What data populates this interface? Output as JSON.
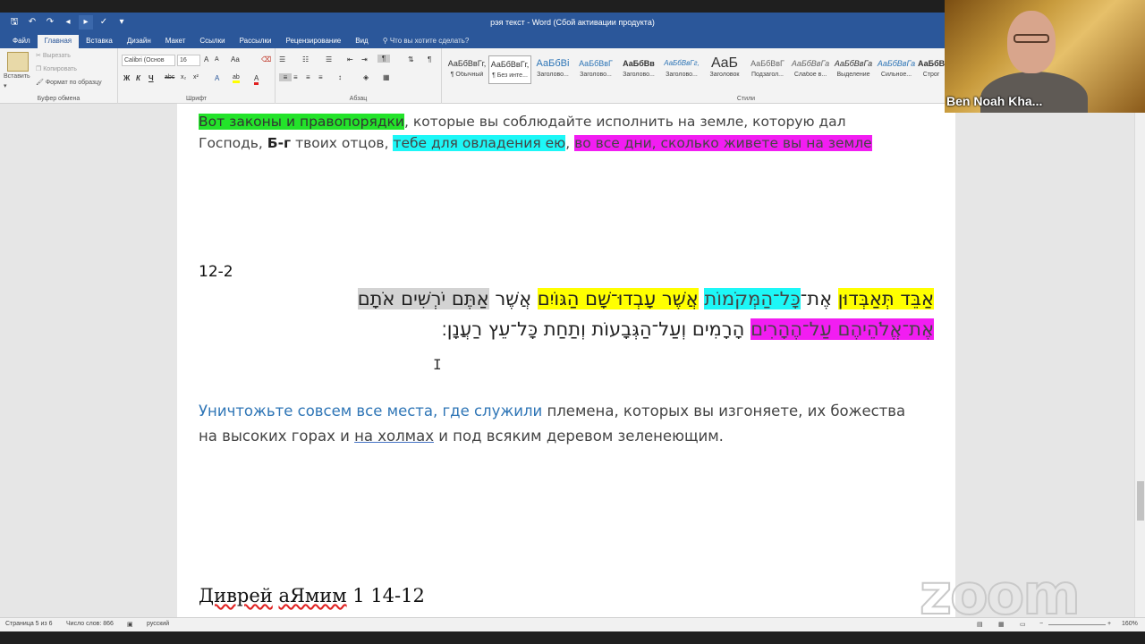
{
  "window": {
    "title": "рэя текст - Word (Сбой активации продукта)"
  },
  "quick_access": {
    "icons": [
      "save-icon",
      "undo-icon",
      "redo-icon",
      "voice-icon",
      "voice-icon",
      "check-icon",
      "more-icon"
    ]
  },
  "tabs": [
    {
      "label": "Файл"
    },
    {
      "label": "Главная",
      "active": true
    },
    {
      "label": "Вставка"
    },
    {
      "label": "Дизайн"
    },
    {
      "label": "Макет"
    },
    {
      "label": "Ссылки"
    },
    {
      "label": "Рассылки"
    },
    {
      "label": "Рецензирование"
    },
    {
      "label": "Вид"
    }
  ],
  "tell_me": "Что вы хотите сделать?",
  "ribbon": {
    "clipboard": {
      "paste": "Вставить",
      "cut": "Вырезать",
      "copy": "Копировать",
      "format_painter": "Формат по образцу",
      "label": "Буфер обмена"
    },
    "font": {
      "font_name": "Calibri (Основ",
      "font_size": "16",
      "grow": "A",
      "shrink": "A",
      "case": "Aa",
      "bold": "Ж",
      "italic": "К",
      "underline": "Ч",
      "strike": "abc",
      "sub": "x₂",
      "sup": "x²",
      "effects": "A",
      "highlight": "ab",
      "color": "A",
      "label": "Шрифт"
    },
    "paragraph": {
      "label": "Абзац"
    },
    "styles": {
      "label": "Стили",
      "items": [
        {
          "sample": "АаБбВвГг,",
          "name": "¶ Обычный"
        },
        {
          "sample": "АаБбВвГг,",
          "name": "¶ Без инте...",
          "selected": true
        },
        {
          "sample": "АаБбВі",
          "name": "Заголово..."
        },
        {
          "sample": "АаБбВвГ",
          "name": "Заголово..."
        },
        {
          "sample": "АаБбВв",
          "name": "Заголово..."
        },
        {
          "sample": "АаБбВвГг,",
          "name": "Заголово..."
        },
        {
          "sample": "AaБ",
          "name": "Заголовок"
        },
        {
          "sample": "АаБбВвГ",
          "name": "Подзагол..."
        },
        {
          "sample": "АаБбВвГа",
          "name": "Слабое в..."
        },
        {
          "sample": "АаБбВвГа",
          "name": "Выделение"
        },
        {
          "sample": "АаБбВвГа",
          "name": "Сильное..."
        },
        {
          "sample": "АаБбВвГ",
          "name": "Строг"
        }
      ]
    }
  },
  "document": {
    "p1_line1": {
      "green": "Вот законы и правопорядки",
      "rest": ", которые вы соблюдайте исполнить на земле, которую дал"
    },
    "p1_line2": {
      "plain1": "Господь, ",
      "bold": "Б-г",
      "plain2": " твоих отцов, ",
      "cyan": "тебе для овладения ею",
      "comma": ",",
      "space": " ",
      "magenta": "во все дни, сколько живете вы на земле"
    },
    "verse_num": "12-2",
    "hebrew_line1": {
      "yellow1": "אַבֵּד תְּאַבְּדוּן",
      "plain1": " אֶת־",
      "cyan": "כָּל־הַמְּקֹמוֹת",
      "space": " ",
      "yellow2": "אֲשֶׁר עָבְדוּ־שָׁם הַגּוֹיִם",
      "plain2": " אֲשֶׁר ",
      "gray": "אַתֶּם יֹרְשִׁים אֹתָם"
    },
    "hebrew_line2": {
      "magenta": "אֶת־אֱלֹהֵיהֶם עַל־הֶהָרִים",
      "plain": " הָרָמִים וְעַל־הַגְּבָעוֹת וְתַחַת כָּל־עֵץ רַעֲנָן׃"
    },
    "p2_line1": {
      "blue": "Уничтожьте совсем все места, где служили",
      "plain": " племена, которых вы изгоняете, их божества"
    },
    "p2_line2": {
      "plain1": "на высоких горах и ",
      "underlined": "на холмах",
      "plain2": " и под всяким деревом зеленеющим."
    },
    "heading": {
      "sq1": "Диврей",
      "space": " ",
      "sq2": "аЯмим",
      "rest": " 1 14-12"
    }
  },
  "status": {
    "page": "Страница 5 из 6",
    "words": "Число слов: 866",
    "lang": "русский",
    "zoom": "160%"
  },
  "webcam": {
    "name": "Ben Noah Kha..."
  },
  "watermark": "zoom"
}
